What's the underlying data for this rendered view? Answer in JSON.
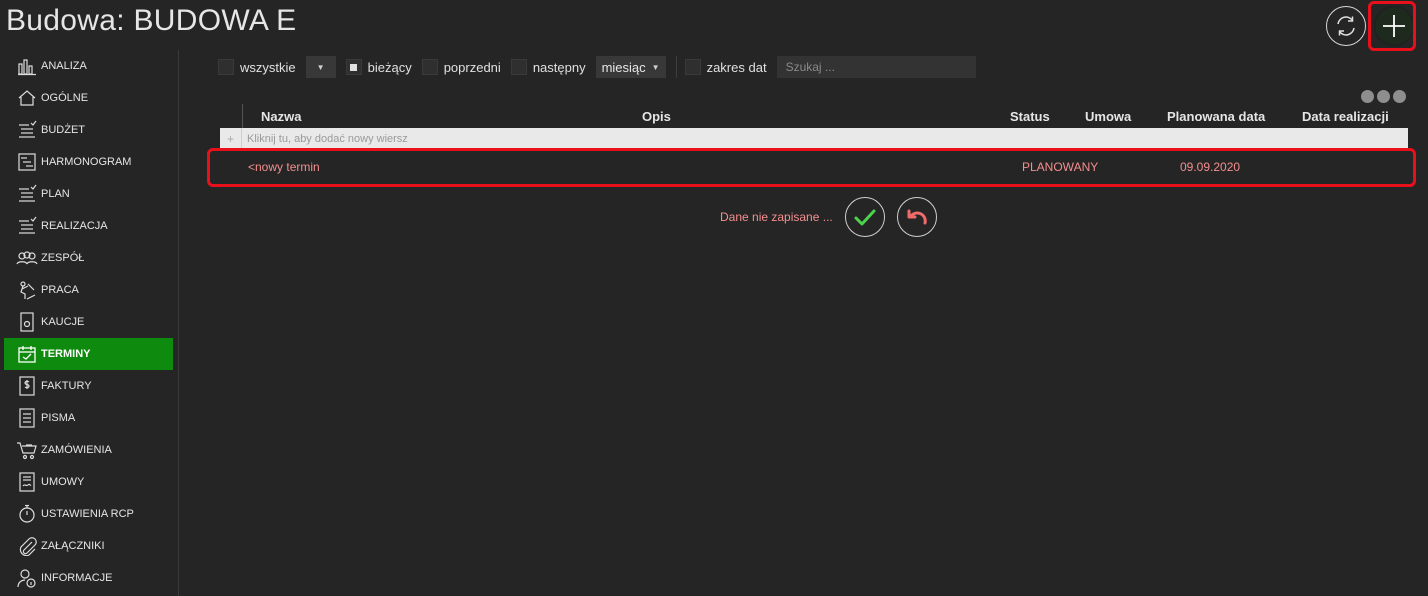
{
  "header": {
    "title": "Budowa: BUDOWA E",
    "refresh_icon": "refresh-icon",
    "add_icon": "plus-icon"
  },
  "sidebar": {
    "items": [
      {
        "label": "ANALIZA",
        "icon": "bar-chart-icon"
      },
      {
        "label": "OGÓLNE",
        "icon": "home-icon"
      },
      {
        "label": "BUDŻET",
        "icon": "checklist-icon"
      },
      {
        "label": "HARMONOGRAM",
        "icon": "schedule-icon"
      },
      {
        "label": "PLAN",
        "icon": "checklist-icon"
      },
      {
        "label": "REALIZACJA",
        "icon": "checklist-icon"
      },
      {
        "label": "ZESPÓŁ",
        "icon": "team-icon"
      },
      {
        "label": "PRACA",
        "icon": "work-icon"
      },
      {
        "label": "KAUCJE",
        "icon": "deposit-icon"
      },
      {
        "label": "TERMINY",
        "icon": "calendar-icon",
        "active": true
      },
      {
        "label": "FAKTURY",
        "icon": "invoice-icon"
      },
      {
        "label": "PISMA",
        "icon": "document-icon"
      },
      {
        "label": "ZAMÓWIENIA",
        "icon": "cart-icon"
      },
      {
        "label": "UMOWY",
        "icon": "contract-icon"
      },
      {
        "label": "USTAWIENIA RCP",
        "icon": "stopwatch-icon"
      },
      {
        "label": "ZAŁĄCZNIKI",
        "icon": "paperclip-icon"
      },
      {
        "label": "INFORMACJE",
        "icon": "user-info-icon"
      }
    ],
    "active_color": "#0e8a0e"
  },
  "toolbar": {
    "all_label": "wszystkie",
    "current_label": "bieżący",
    "previous_label": "poprzedni",
    "next_label": "następny",
    "period_value": "miesiąc",
    "date_range_label": "zakres dat",
    "search_placeholder": "Szukaj ..."
  },
  "grid": {
    "columns": [
      "Nazwa",
      "Opis",
      "Status",
      "Umowa",
      "Planowana data",
      "Data realizacji"
    ],
    "new_row_hint": "Kliknij tu, aby dodać nowy wiersz",
    "rows": [
      {
        "nazwa": "<nowy termin",
        "opis": "",
        "status": "PLANOWANY",
        "umowa": "",
        "planowana_data": "09.09.2020",
        "data_realizacji": ""
      }
    ]
  },
  "unsaved": {
    "text": "Dane nie zapisane ...",
    "save_icon": "check-icon",
    "undo_icon": "undo-icon"
  },
  "colors": {
    "highlight": "#e8101a",
    "unsaved_text": "#f48e8e",
    "check": "#4cd34c",
    "undo": "#f06a6a"
  }
}
